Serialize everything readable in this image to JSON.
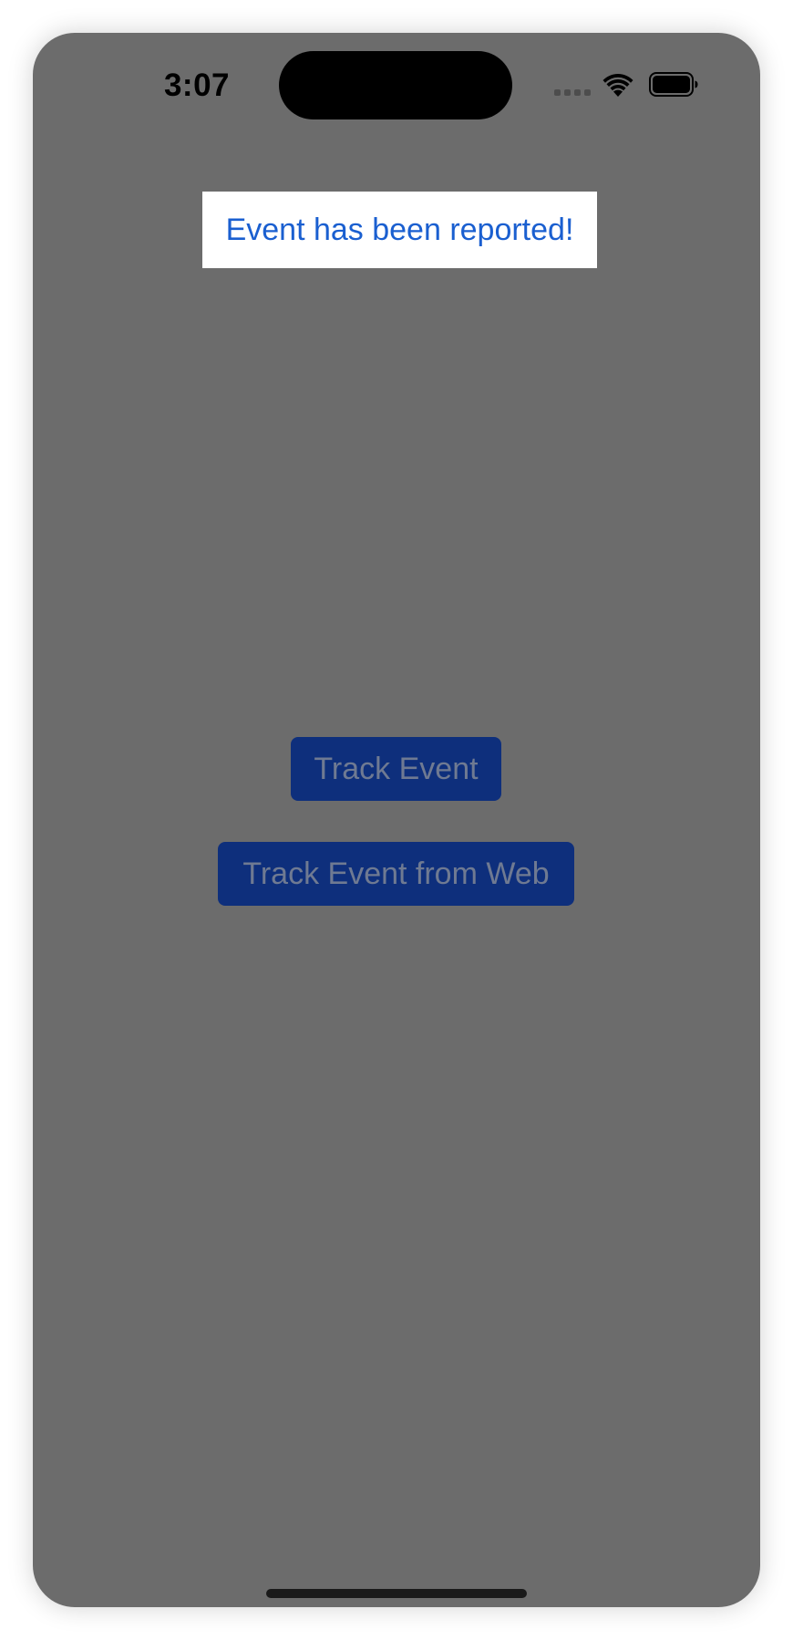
{
  "status_bar": {
    "time": "3:07",
    "icons": [
      "cellular-signal-icon",
      "wifi-icon",
      "battery-icon"
    ]
  },
  "toast": {
    "message": "Event has been reported!"
  },
  "main": {
    "track_event_label": "Track Event",
    "track_event_web_label": "Track Event from Web"
  },
  "colors": {
    "background_dimmed": "#6c6c6c",
    "toast_background": "#ffffff",
    "toast_text": "#1a5fd0",
    "button_background": "#0e2f7c",
    "button_text": "#6f7a92"
  }
}
